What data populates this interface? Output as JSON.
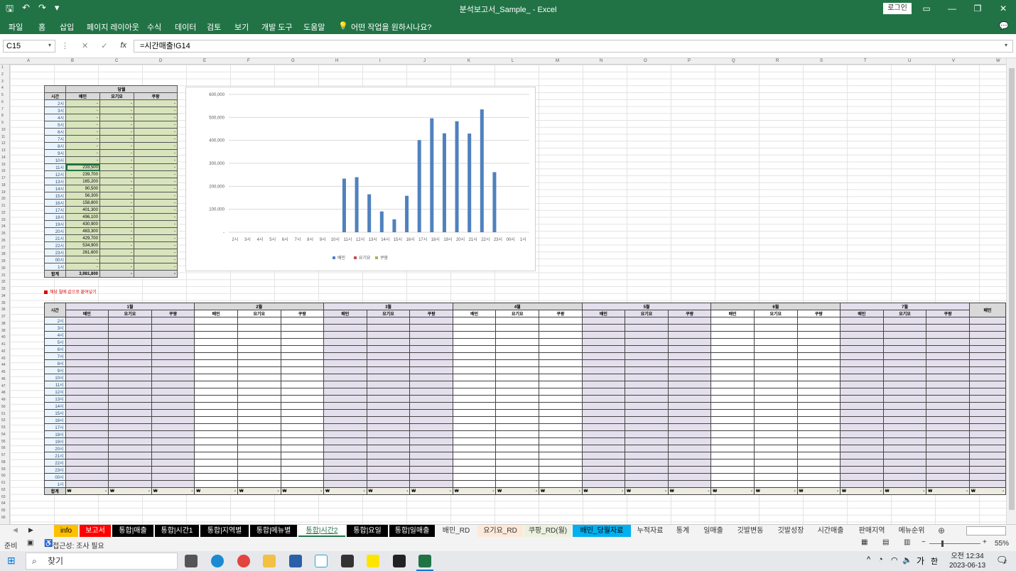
{
  "titlebar": {
    "title": "분석보고서_Sample_  -  Excel",
    "login": "로그인",
    "undo_icon": "undo-icon"
  },
  "menu": [
    "파일",
    "홈",
    "삽입",
    "페이지 레이아웃",
    "수식",
    "데이터",
    "검토",
    "보기",
    "개발 도구",
    "도움말",
    "어떤 작업을 원하시나요?"
  ],
  "formula": {
    "namebox": "C15",
    "fx": "fx",
    "value": "=시간매출!G14"
  },
  "columns": [
    "A",
    "B",
    "C",
    "D",
    "E",
    "F",
    "G",
    "H",
    "I",
    "J",
    "K",
    "L",
    "M",
    "N",
    "O",
    "P",
    "Q",
    "R",
    "S",
    "T",
    "U",
    "V",
    "W",
    "X"
  ],
  "table1": {
    "title": "당월",
    "headers": [
      "시간",
      "배민",
      "요기요",
      "쿠팡"
    ],
    "rows": [
      [
        "2시",
        "-",
        "-",
        "-"
      ],
      [
        "3시",
        "-",
        "-",
        "-"
      ],
      [
        "4시",
        "-",
        "-",
        "-"
      ],
      [
        "5시",
        "-",
        "-",
        "-"
      ],
      [
        "6시",
        "-",
        "-",
        "-"
      ],
      [
        "7시",
        "-",
        "-",
        "-"
      ],
      [
        "8시",
        "-",
        "-",
        "-"
      ],
      [
        "9시",
        "-",
        "-",
        "-"
      ],
      [
        "10시",
        "-",
        "-",
        "-"
      ],
      [
        "11시",
        "233,500",
        "-",
        "-"
      ],
      [
        "12시",
        "239,700",
        "-",
        "-"
      ],
      [
        "13시",
        "165,200",
        "-",
        "-"
      ],
      [
        "14시",
        "90,500",
        "-",
        "-"
      ],
      [
        "15시",
        "56,300",
        "-",
        "-"
      ],
      [
        "16시",
        "158,800",
        "-",
        "-"
      ],
      [
        "17시",
        "401,300",
        "-",
        "-"
      ],
      [
        "18시",
        "496,100",
        "-",
        "-"
      ],
      [
        "19시",
        "430,900",
        "-",
        "-"
      ],
      [
        "20시",
        "483,300",
        "-",
        "-"
      ],
      [
        "21시",
        "429,700",
        "-",
        "-"
      ],
      [
        "22시",
        "534,900",
        "-",
        "-"
      ],
      [
        "23시",
        "261,600",
        "-",
        "-"
      ],
      [
        "00시",
        "-",
        "-",
        "-"
      ],
      [
        "1시",
        "-",
        "-",
        "-"
      ]
    ],
    "total": [
      "합계",
      "3,981,800",
      "-",
      "-"
    ]
  },
  "note": "해당 월에 값으로 붙여넣기",
  "table2": {
    "months": [
      "1월",
      "2월",
      "3월",
      "4월",
      "5월",
      "6월",
      "7월"
    ],
    "sub": [
      "배민",
      "요기요",
      "쿠팡"
    ],
    "last_col": "배민",
    "time_header": "시간",
    "times": [
      "2시",
      "3시",
      "4시",
      "5시",
      "6시",
      "7시",
      "8시",
      "9시",
      "10시",
      "11시",
      "12시",
      "13시",
      "14시",
      "15시",
      "16시",
      "17시",
      "18시",
      "19시",
      "20시",
      "21시",
      "22시",
      "23시",
      "00시",
      "1시"
    ],
    "total_label": "합계",
    "won": "₩",
    "dash": "-"
  },
  "chart_data": {
    "type": "bar",
    "categories": [
      "2시",
      "3시",
      "4시",
      "5시",
      "6시",
      "7시",
      "8시",
      "9시",
      "10시",
      "11시",
      "12시",
      "13시",
      "14시",
      "15시",
      "16시",
      "17시",
      "18시",
      "19시",
      "20시",
      "21시",
      "22시",
      "23시",
      "00시",
      "1시"
    ],
    "series": [
      {
        "name": "배민",
        "color": "#4f81bd",
        "values": [
          0,
          0,
          0,
          0,
          0,
          0,
          0,
          0,
          0,
          233500,
          239700,
          165200,
          90500,
          56300,
          158800,
          401300,
          496100,
          430900,
          483300,
          429700,
          534900,
          261600,
          0,
          0
        ]
      },
      {
        "name": "요기요",
        "color": "#c0504d",
        "values": [
          0,
          0,
          0,
          0,
          0,
          0,
          0,
          0,
          0,
          0,
          0,
          0,
          0,
          0,
          0,
          0,
          0,
          0,
          0,
          0,
          0,
          0,
          0,
          0
        ]
      },
      {
        "name": "쿠팡",
        "color": "#9bbb59",
        "values": [
          0,
          0,
          0,
          0,
          0,
          0,
          0,
          0,
          0,
          0,
          0,
          0,
          0,
          0,
          0,
          0,
          0,
          0,
          0,
          0,
          0,
          0,
          0,
          0
        ]
      }
    ],
    "y_ticks": [
      "-",
      "100,000",
      "200,000",
      "300,000",
      "400,000",
      "500,000",
      "600,000"
    ],
    "ylim": [
      0,
      600000
    ],
    "grid": true,
    "legend": "bottom"
  },
  "tabs": [
    {
      "label": "info",
      "bg": "#ffc000",
      "fg": "#000"
    },
    {
      "label": "보고서",
      "bg": "#ff0000",
      "fg": "#fff"
    },
    {
      "label": "통합|매출",
      "bg": "#000",
      "fg": "#fff"
    },
    {
      "label": "통합|시간1",
      "bg": "#000",
      "fg": "#fff"
    },
    {
      "label": "통합|지역별",
      "bg": "#000",
      "fg": "#fff"
    },
    {
      "label": "통합|메뉴별",
      "bg": "#000",
      "fg": "#fff"
    },
    {
      "label": "통합|시간2",
      "bg": "#fff",
      "fg": "#217346"
    },
    {
      "label": "통합|요일",
      "bg": "#000",
      "fg": "#fff"
    },
    {
      "label": "통합|일매출",
      "bg": "#000",
      "fg": "#fff"
    },
    {
      "label": "배민_RD",
      "bg": "#f3f3f3",
      "fg": "#333"
    },
    {
      "label": "요기요_RD",
      "bg": "#fde9d9",
      "fg": "#333"
    },
    {
      "label": "쿠팡_RD(월)",
      "bg": "#ebf1de",
      "fg": "#333"
    },
    {
      "label": "배민_당월자료",
      "bg": "#00b0f0",
      "fg": "#000"
    },
    {
      "label": "누적자료",
      "bg": "#f3f3f3",
      "fg": "#333"
    },
    {
      "label": "통계",
      "bg": "#f3f3f3",
      "fg": "#333"
    },
    {
      "label": "일매출",
      "bg": "#f3f3f3",
      "fg": "#333"
    },
    {
      "label": "깃발변동",
      "bg": "#f3f3f3",
      "fg": "#333"
    },
    {
      "label": "깃발성장",
      "bg": "#f3f3f3",
      "fg": "#333"
    },
    {
      "label": "시간매출",
      "bg": "#f3f3f3",
      "fg": "#333"
    },
    {
      "label": "판매지역",
      "bg": "#f3f3f3",
      "fg": "#333"
    },
    {
      "label": "메뉴순위",
      "bg": "#f3f3f3",
      "fg": "#333"
    }
  ],
  "status": {
    "ready": "준비",
    "accessibility": "접근성: 조사 필요",
    "zoom": "55%"
  },
  "taskbar": {
    "search": "찾기",
    "time": "오전 12:34",
    "date": "2023-06-13",
    "ime": "가",
    "notify_count": "2"
  }
}
